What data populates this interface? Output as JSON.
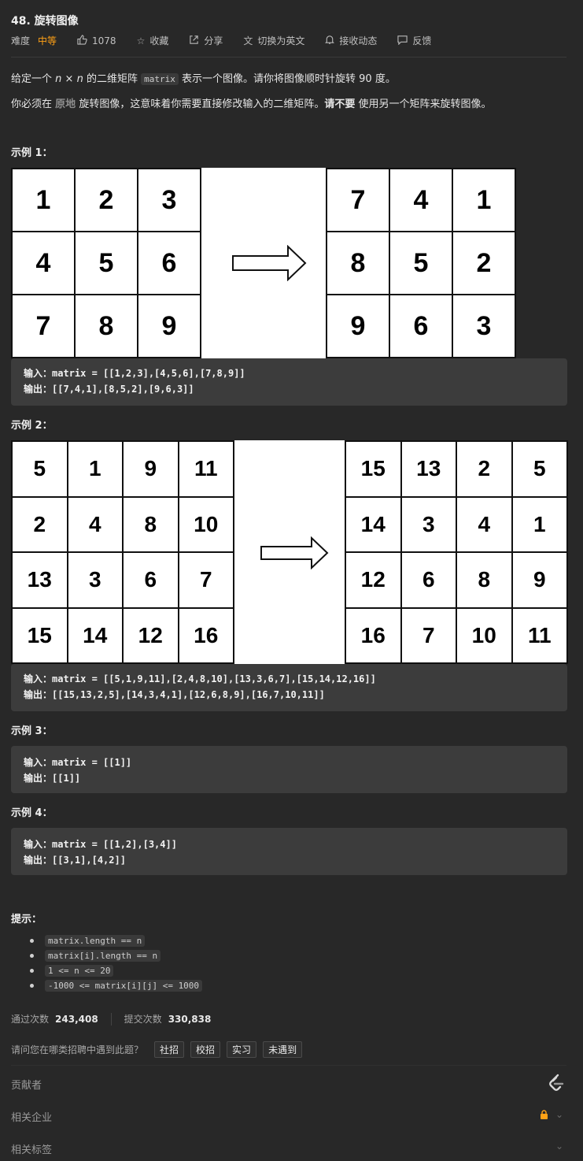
{
  "problem": {
    "title": "48. 旋转图像",
    "difficulty_label": "难度",
    "difficulty": "中等",
    "likes": "1078",
    "favorite": "收藏",
    "share": "分享",
    "switch_lang": "切换为英文",
    "notify": "接收动态",
    "feedback": "反馈"
  },
  "description": {
    "p1_a": "给定一个",
    "p1_n1": "n",
    "p1_x": "×",
    "p1_n2": "n",
    "p1_b": "的二维矩阵",
    "p1_code": "matrix",
    "p1_c": "表示一个图像。请你将图像顺时针旋转 90 度。",
    "p2_a": "你必须在",
    "p2_inplace": "原地",
    "p2_b": "旋转图像，这意味着你需要直接修改输入的二维矩阵。",
    "p2_bold": "请不要",
    "p2_c": "使用另一个矩阵来旋转图像。"
  },
  "examples": [
    {
      "title": "示例 1：",
      "input_label": "输入：",
      "input": "matrix = [[1,2,3],[4,5,6],[7,8,9]]",
      "output_label": "输出：",
      "output": "[[7,4,1],[8,5,2],[9,6,3]]",
      "left_grid": [
        [
          "1",
          "2",
          "3"
        ],
        [
          "4",
          "5",
          "6"
        ],
        [
          "7",
          "8",
          "9"
        ]
      ],
      "right_grid": [
        [
          "7",
          "4",
          "1"
        ],
        [
          "8",
          "5",
          "2"
        ],
        [
          "9",
          "6",
          "3"
        ]
      ]
    },
    {
      "title": "示例 2：",
      "input_label": "输入：",
      "input": "matrix = [[5,1,9,11],[2,4,8,10],[13,3,6,7],[15,14,12,16]]",
      "output_label": "输出：",
      "output": "[[15,13,2,5],[14,3,4,1],[12,6,8,9],[16,7,10,11]]",
      "left_grid": [
        [
          "5",
          "1",
          "9",
          "11"
        ],
        [
          "2",
          "4",
          "8",
          "10"
        ],
        [
          "13",
          "3",
          "6",
          "7"
        ],
        [
          "15",
          "14",
          "12",
          "16"
        ]
      ],
      "right_grid": [
        [
          "15",
          "13",
          "2",
          "5"
        ],
        [
          "14",
          "3",
          "4",
          "1"
        ],
        [
          "12",
          "6",
          "8",
          "9"
        ],
        [
          "16",
          "7",
          "10",
          "11"
        ]
      ]
    },
    {
      "title": "示例 3：",
      "input_label": "输入：",
      "input": "matrix = [[1]]",
      "output_label": "输出：",
      "output": "[[1]]"
    },
    {
      "title": "示例 4：",
      "input_label": "输入：",
      "input": "matrix = [[1,2],[3,4]]",
      "output_label": "输出：",
      "output": "[[3,1],[4,2]]"
    }
  ],
  "hints": {
    "title": "提示：",
    "items": [
      "matrix.length == n",
      "matrix[i].length == n",
      "1 <= n <= 20",
      "-1000 <= matrix[i][j] <= 1000"
    ]
  },
  "stats": {
    "accepted_label": "通过次数",
    "accepted": "243,408",
    "submitted_label": "提交次数",
    "submitted": "330,838"
  },
  "interview": {
    "question": "请问您在哪类招聘中遇到此题？",
    "options": [
      "社招",
      "校招",
      "实习",
      "未遇到"
    ]
  },
  "sections": {
    "contributors": "贡献者",
    "companies": "相关企业",
    "tags": "相关标签"
  },
  "colors": {
    "background": "#282828",
    "accent": "#ffa116",
    "code_box": "#3c3c3c"
  }
}
